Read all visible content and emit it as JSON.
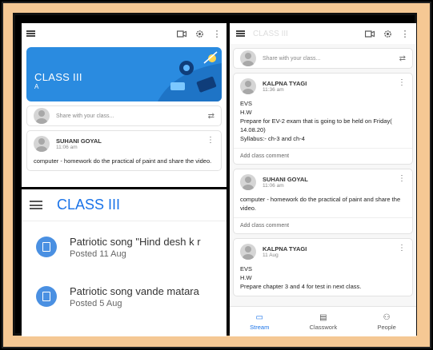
{
  "top_left": {
    "class_title": "CLASS III",
    "class_section": "A",
    "share_placeholder": "Share with your class...",
    "post": {
      "author": "SUHANI GOYAL",
      "time": "11:06 am",
      "body": "computer - homework do the practical of paint and share the video."
    }
  },
  "bottom_left": {
    "title": "CLASS III",
    "items": [
      {
        "title": "Patriotic song \"Hind desh k r",
        "date": "Posted 11 Aug"
      },
      {
        "title": "Patriotic song vande matara",
        "date": "Posted 5 Aug"
      }
    ]
  },
  "right": {
    "header_title": "CLASS III",
    "share_placeholder": "Share with your class...",
    "posts": [
      {
        "author": "KALPNA TYAGI",
        "time": "11:36 am",
        "lines": [
          "EVS",
          "H.W",
          "Prepare for EV-2 exam that is going to be held on Friday( 14.08.20)",
          "Syllabus:- ch-3 and ch-4"
        ],
        "comment": "Add class comment"
      },
      {
        "author": "SUHANI GOYAL",
        "time": "11:06 am",
        "lines": [
          "computer - homework do the practical of paint and share the video."
        ],
        "comment": "Add class comment"
      },
      {
        "author": "KALPNA TYAGI",
        "time": "11 Aug",
        "lines": [
          "EVS",
          "H.W",
          "Prepare chapter 3 and 4 for test in next class."
        ],
        "comment": ""
      }
    ],
    "nav": {
      "stream": "Stream",
      "classwork": "Classwork",
      "people": "People"
    }
  },
  "colors": {
    "accent": "#1a73e8",
    "banner": "#2a8be0",
    "frame": "#f5c894"
  }
}
